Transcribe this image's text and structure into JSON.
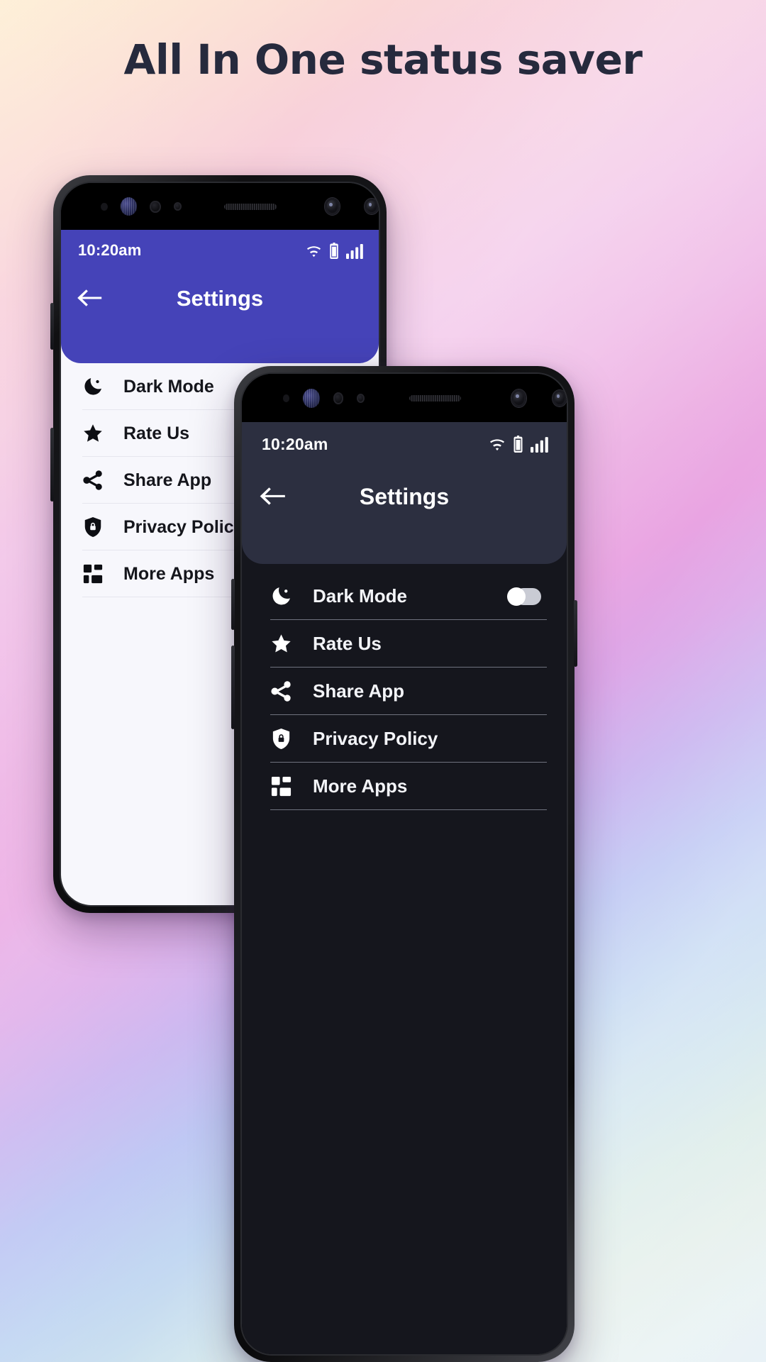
{
  "page": {
    "headline": "All In One status saver"
  },
  "icons": {
    "back": "arrow-left-icon",
    "wifi": "wifi-icon",
    "battery": "battery-icon",
    "signal": "signal-bars-icon",
    "dark_mode": "moon-icon",
    "rate_us": "star-icon",
    "share_app": "share-icon",
    "privacy_policy": "shield-lock-icon",
    "more_apps": "grid-apps-icon"
  },
  "colors": {
    "light_accent": "#4543b8",
    "dark_appbar": "#2c2f40",
    "dark_surface": "#15161d",
    "light_surface": "#f7f7fc",
    "title_text": "#262a3d",
    "toggle_thumb_light": "#3b36b5",
    "toggle_thumb_dark": "#ffffff"
  },
  "phone_light": {
    "status": {
      "time": "10:20am",
      "wifi": "wifi-icon",
      "battery": "battery-icon",
      "signal": "signal-bars-icon"
    },
    "appbar": {
      "back_label": "Back",
      "title": "Settings"
    },
    "settings_items": [
      {
        "label": "Dark Mode",
        "icon": "moon-icon",
        "has_toggle": true,
        "toggle_on": false
      },
      {
        "label": "Rate Us",
        "icon": "star-icon",
        "has_toggle": false
      },
      {
        "label": "Share App",
        "icon": "share-icon",
        "has_toggle": false
      },
      {
        "label": "Privacy Policy",
        "icon": "shield-lock-icon",
        "has_toggle": false
      },
      {
        "label": "More Apps",
        "icon": "grid-apps-icon",
        "has_toggle": false
      }
    ]
  },
  "phone_dark": {
    "status": {
      "time": "10:20am",
      "wifi": "wifi-icon",
      "battery": "battery-icon",
      "signal": "signal-bars-icon"
    },
    "appbar": {
      "back_label": "Back",
      "title": "Settings"
    },
    "settings_items": [
      {
        "label": "Dark Mode",
        "icon": "moon-icon",
        "has_toggle": true,
        "toggle_on": true
      },
      {
        "label": "Rate Us",
        "icon": "star-icon",
        "has_toggle": false
      },
      {
        "label": "Share App",
        "icon": "share-icon",
        "has_toggle": false
      },
      {
        "label": "Privacy Policy",
        "icon": "shield-lock-icon",
        "has_toggle": false
      },
      {
        "label": "More Apps",
        "icon": "grid-apps-icon",
        "has_toggle": false
      }
    ]
  }
}
